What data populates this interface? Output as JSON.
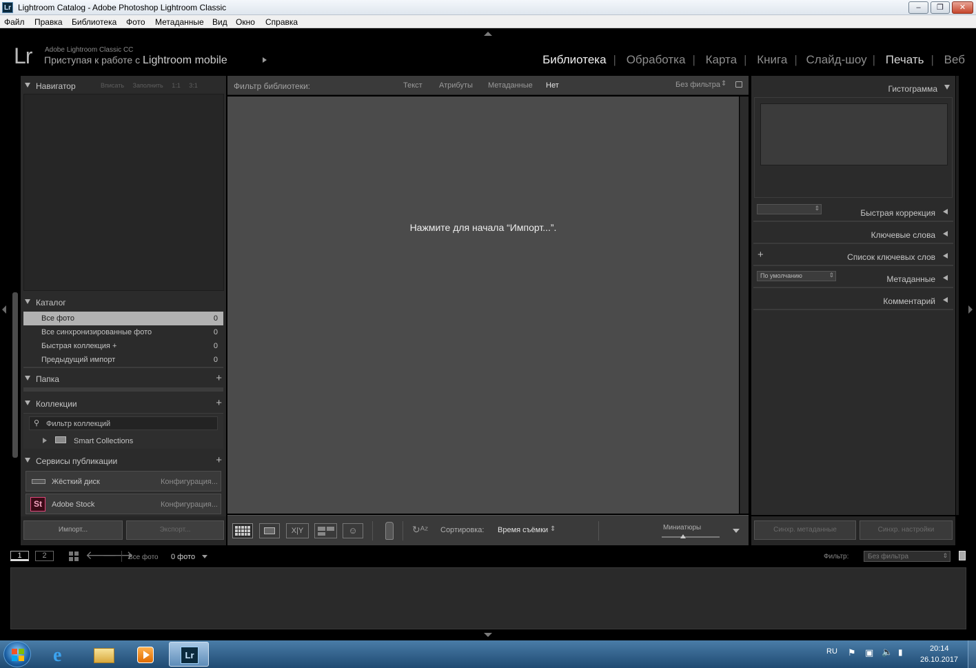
{
  "window": {
    "title": "Lightroom Catalog - Adobe Photoshop Lightroom Classic",
    "app_icon": "Lr"
  },
  "menu": [
    "Файл",
    "Правка",
    "Библиотека",
    "Фото",
    "Метаданные",
    "Вид",
    "Окно",
    "Справка"
  ],
  "brand": {
    "logo": "Lr",
    "line1": "Adobe Lightroom Classic CC",
    "line2_prefix": "Приступая к работе с",
    "line2_product": "Lightroom mobile"
  },
  "modules": {
    "library": "Библиотека",
    "develop": "Обработка",
    "map": "Карта",
    "book": "Книга",
    "slideshow": "Слайд-шоу",
    "print": "Печать",
    "web": "Веб",
    "active": "Библиотека"
  },
  "left_panel": {
    "navigator": {
      "title": "Навигатор",
      "opts": [
        "Вписать",
        "Заполнить",
        "1:1",
        "3:1"
      ]
    },
    "catalog": {
      "title": "Каталог",
      "items": [
        {
          "name": "Все фото",
          "count": "0"
        },
        {
          "name": "Все синхронизированные фото",
          "count": "0"
        },
        {
          "name": "Быстрая коллекция  +",
          "count": "0"
        },
        {
          "name": "Предыдущий импорт",
          "count": "0"
        }
      ]
    },
    "folders": {
      "title": "Папка"
    },
    "collections": {
      "title": "Коллекции",
      "filter_placeholder": "Фильтр коллекций",
      "smart": "Smart Collections"
    },
    "publish": {
      "title": "Сервисы публикации",
      "services": [
        {
          "name": "Жёсткий диск",
          "action": "Конфигурация..."
        },
        {
          "name": "Adobe Stock",
          "action": "Конфигурация..."
        }
      ]
    },
    "import_btn": "Импорт...",
    "export_btn": "Экспорт..."
  },
  "filter_bar": {
    "label": "Фильтр библиотеки:",
    "text": "Текст",
    "attributes": "Атрибуты",
    "metadata": "Метаданные",
    "none": "Нет",
    "preset": "Без фильтра"
  },
  "main": {
    "message": "Нажмите для начала “Импорт...”."
  },
  "toolbar": {
    "sort_label": "Сортировка:",
    "sort_value": "Время съёмки",
    "thumbs_label": "Миниатюры",
    "xy": "X|Y"
  },
  "right_panel": {
    "histogram": "Гистограмма",
    "quick_develop": "Быстрая коррекция",
    "keywords": "Ключевые слова",
    "keyword_list": "Список ключевых слов",
    "metadata": "Метаданные",
    "metadata_preset": "По умолчанию",
    "comments": "Комментарий",
    "sync_meta": "Синхр. метаданные",
    "sync_settings": "Синхр. настройки"
  },
  "filmstrip": {
    "screen1": "1",
    "screen2": "2",
    "source": "Все фото",
    "count": "0 фото",
    "filter_label": "Фильтр:",
    "filter_value": "Без фильтра"
  },
  "taskbar": {
    "lang": "RU",
    "time": "20:14",
    "date": "26.10.2017"
  }
}
